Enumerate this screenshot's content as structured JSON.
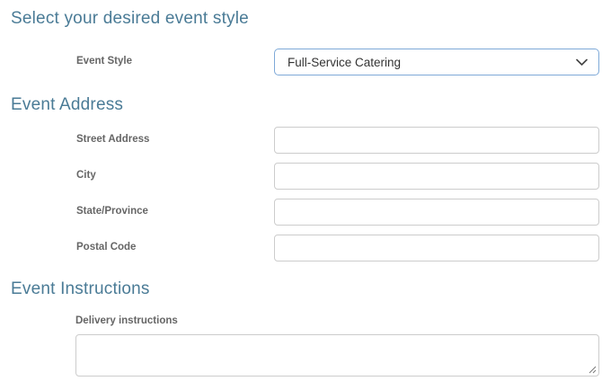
{
  "colors": {
    "heading": "#4a7b96",
    "label": "#666666",
    "input_border": "#cccccc",
    "select_border": "#7ea9d8",
    "text": "#333333",
    "background": "#ffffff"
  },
  "icons": {
    "chevron_down": "chevron-down-icon",
    "resize_handle": "resize-handle-icon"
  },
  "sections": {
    "event_style": {
      "title": "Select your desired event style",
      "field": {
        "label": "Event Style",
        "value": "Full-Service Catering"
      }
    },
    "event_address": {
      "title": "Event Address",
      "fields": [
        {
          "label": "Street Address",
          "value": ""
        },
        {
          "label": "City",
          "value": ""
        },
        {
          "label": "State/Province",
          "value": ""
        },
        {
          "label": "Postal Code",
          "value": ""
        }
      ]
    },
    "event_instructions": {
      "title": "Event Instructions",
      "field": {
        "label": "Delivery instructions",
        "value": ""
      }
    }
  }
}
